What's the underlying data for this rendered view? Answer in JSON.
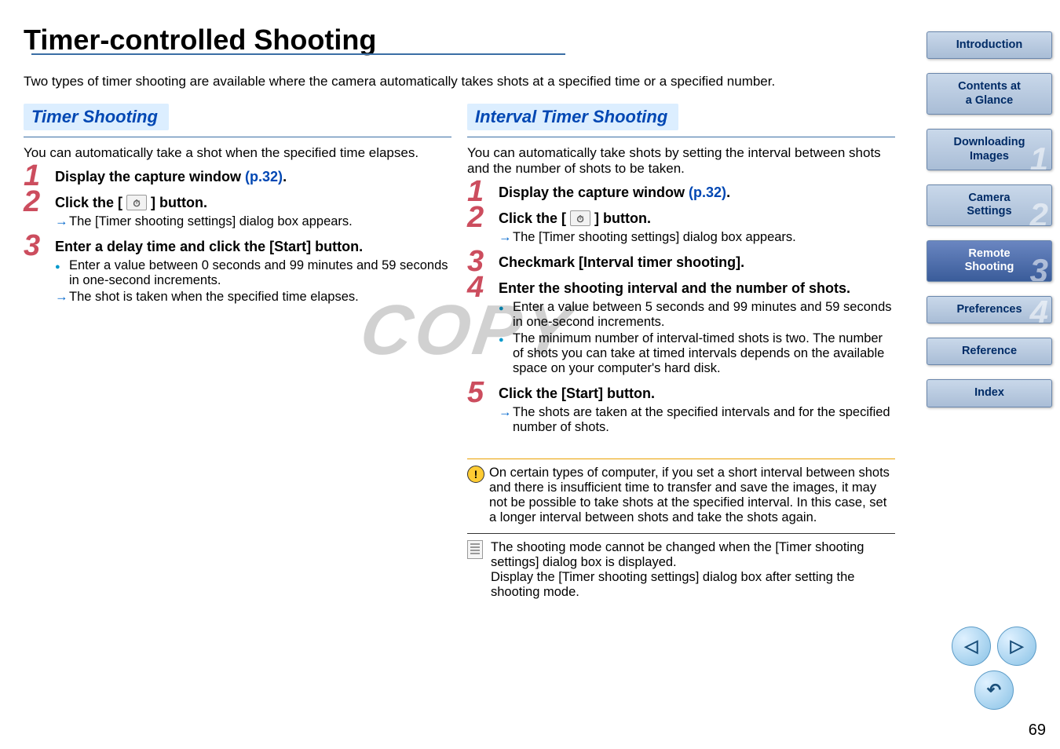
{
  "title": "Timer-controlled Shooting",
  "intro": "Two types of timer shooting are available where the camera automatically takes shots at a specified time or a specified number.",
  "watermark": "COPY",
  "page_number": "69",
  "sections": {
    "left": {
      "heading": "Timer Shooting",
      "desc": "You can automatically take a shot when the specified time elapses.",
      "steps": [
        {
          "num": "1",
          "title_pre": "Display the capture window ",
          "pref": "(p.32)",
          "title_post": "."
        },
        {
          "num": "2",
          "title_pre": "Click the [ ",
          "has_icon": true,
          "title_post": " ] button.",
          "bullets": [
            {
              "type": "arrow",
              "text": "The [Timer shooting settings] dialog box appears."
            }
          ]
        },
        {
          "num": "3",
          "title_pre": "Enter a delay time and click the [Start] button.",
          "bullets": [
            {
              "type": "dot",
              "text": "Enter a value between 0 seconds and 99 minutes and 59 seconds in one-second increments."
            },
            {
              "type": "arrow",
              "text": "The shot is taken when the specified time elapses."
            }
          ]
        }
      ]
    },
    "right": {
      "heading": "Interval Timer Shooting",
      "desc": "You can automatically take shots by setting the interval between shots and the number of shots to be taken.",
      "steps": [
        {
          "num": "1",
          "title_pre": "Display the capture window ",
          "pref": "(p.32)",
          "title_post": "."
        },
        {
          "num": "2",
          "title_pre": "Click the [ ",
          "has_icon": true,
          "title_post": " ] button.",
          "bullets": [
            {
              "type": "arrow",
              "text": "The [Timer shooting settings] dialog box appears."
            }
          ]
        },
        {
          "num": "3",
          "title_pre": "Checkmark [Interval timer shooting]."
        },
        {
          "num": "4",
          "title_pre": "Enter the shooting interval and the number of shots.",
          "bullets": [
            {
              "type": "dot",
              "text": "Enter a value between 5 seconds and 99 minutes and 59 seconds in one-second increments."
            },
            {
              "type": "dot",
              "text": "The minimum number of interval-timed shots is two. The number of shots you can take at timed intervals depends on the available space on your computer's hard disk."
            }
          ]
        },
        {
          "num": "5",
          "title_pre": "Click the [Start] button.",
          "bullets": [
            {
              "type": "arrow",
              "text": "The shots are taken at the specified intervals and for the specified number of shots."
            }
          ]
        }
      ],
      "note1": "On certain types of computer, if you set a short interval between shots and there is insufficient time to transfer and save the images, it may not be possible to take shots at the specified interval. In this case, set a longer interval between shots and take the shots again.",
      "note2": "The shooting mode cannot be changed when the [Timer shooting settings] dialog box is displayed.\nDisplay the [Timer shooting settings] dialog box after setting the shooting mode."
    }
  },
  "nav": [
    {
      "label": "Introduction",
      "num": ""
    },
    {
      "label": "Contents at a Glance",
      "num": ""
    },
    {
      "label": "Downloading Images",
      "num": "1"
    },
    {
      "label": "Camera Settings",
      "num": "2"
    },
    {
      "label": "Remote Shooting",
      "num": "3",
      "active": true
    },
    {
      "label": "Preferences",
      "num": "4"
    },
    {
      "label": "Reference",
      "num": ""
    },
    {
      "label": "Index",
      "num": ""
    }
  ]
}
